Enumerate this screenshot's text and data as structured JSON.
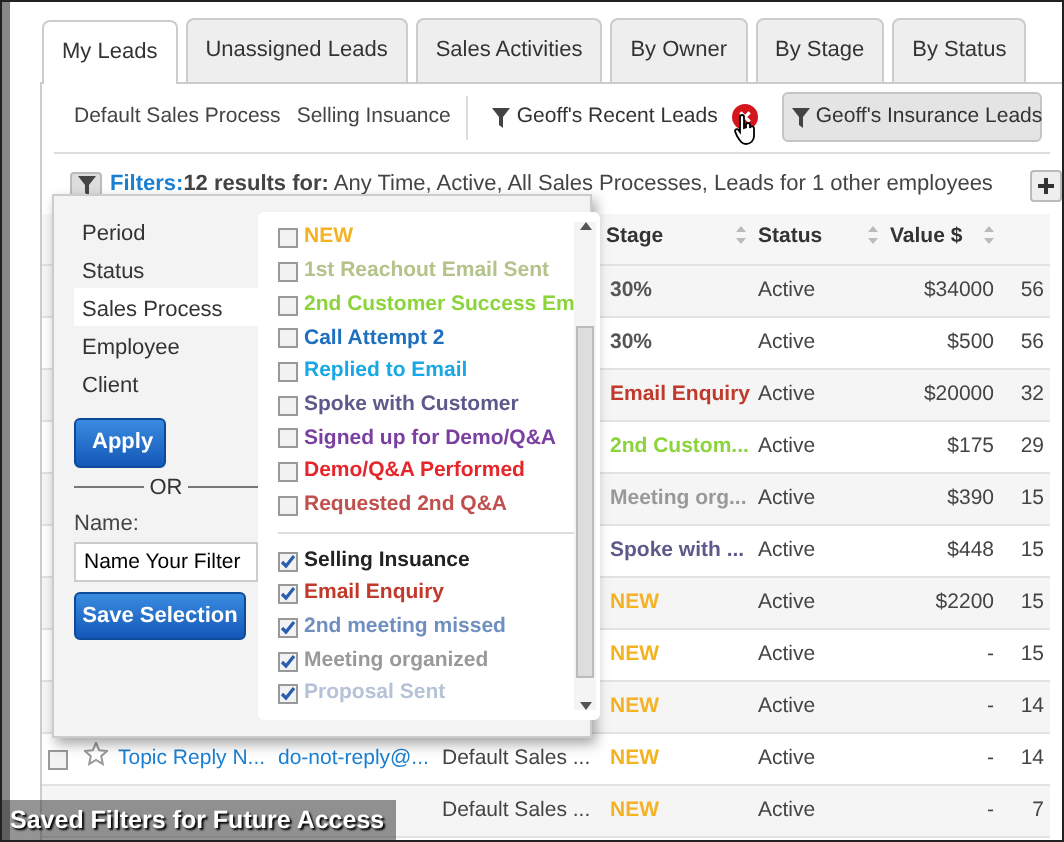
{
  "tabs": [
    {
      "label": "My Leads",
      "selected": true
    },
    {
      "label": "Unassigned Leads",
      "selected": false
    },
    {
      "label": "Sales Activities",
      "selected": false
    },
    {
      "label": "By Owner",
      "selected": false
    },
    {
      "label": "By Stage",
      "selected": false
    },
    {
      "label": "By Status",
      "selected": false
    }
  ],
  "subnav": {
    "processes": [
      "Default Sales Process",
      "Selling Insuance"
    ],
    "saved_filters": [
      {
        "label": "Geoff's Recent Leads",
        "selected": false,
        "removable": true
      },
      {
        "label": "Geoff's Insurance Leads",
        "selected": true,
        "removable": false
      }
    ]
  },
  "filter_bar": {
    "link": "Filters:",
    "summary": "**12 results for:** Any Time, Active, All Sales Processes, Leads for 1 other employees"
  },
  "table": {
    "columns": [
      "Stage",
      "Status",
      "Value $"
    ],
    "rows": [
      {
        "stage": {
          "text": "30%",
          "color": "#555555"
        },
        "status": "Active",
        "value": "$34000",
        "column_9": "56"
      },
      {
        "stage": {
          "text": "30%",
          "color": "#555555"
        },
        "status": "Active",
        "value": "$500",
        "column_9": "56"
      },
      {
        "stage": {
          "text": "Email Enquiry",
          "color": "#c0392b"
        },
        "status": "Active",
        "value": "$20000",
        "column_9": "32"
      },
      {
        "stage": {
          "text": "2nd Custom...",
          "color": "#8cd43c"
        },
        "status": "Active",
        "value": "$175",
        "column_9": "29"
      },
      {
        "stage": {
          "text": "Meeting org...",
          "color": "#999999"
        },
        "status": "Active",
        "value": "$390",
        "column_9": "15"
      },
      {
        "stage": {
          "text": "Spoke with ...",
          "color": "#5c5a8a"
        },
        "status": "Active",
        "value": "$448",
        "column_9": "15"
      },
      {
        "stage": {
          "text": "NEW",
          "color": "#f5b324"
        },
        "status": "Active",
        "value": "$2200",
        "column_9": "15"
      },
      {
        "stage": {
          "text": "NEW",
          "color": "#f5b324"
        },
        "status": "Active",
        "value": "-",
        "column_9": "15"
      },
      {
        "stage": {
          "text": "NEW",
          "color": "#f5b324"
        },
        "status": "Active",
        "value": "-",
        "column_9": "14"
      },
      {
        "checked": false,
        "starred": false,
        "topic": "Topic Reply N...",
        "email": "do-not-reply@...",
        "process": "Default Sales ...",
        "stage": {
          "text": "NEW",
          "color": "#f5b324"
        },
        "status": "Active",
        "value": "-",
        "column_9": "14"
      },
      {
        "process": "Default Sales ...",
        "stage": {
          "text": "NEW",
          "color": "#f5b324"
        },
        "status": "Active",
        "value": "-",
        "column_9": "7"
      }
    ]
  },
  "filter_popup": {
    "menu": [
      {
        "label": "Period",
        "selected": false
      },
      {
        "label": "Status",
        "selected": false
      },
      {
        "label": "Sales Process",
        "selected": true
      },
      {
        "label": "Employee",
        "selected": false
      },
      {
        "label": "Client",
        "selected": false
      }
    ],
    "apply": "Apply",
    "or": "OR",
    "name_label": "Name:",
    "name_value": "Name Your Filter",
    "save": "Save Selection",
    "groups": [
      [
        {
          "label": "NEW",
          "checked": false,
          "color": "#f5b324"
        },
        {
          "label": "1st Reachout Email Sent",
          "checked": false,
          "color": "#b3c38a"
        },
        {
          "label": "2nd Customer Success Em",
          "checked": false,
          "color": "#8cd43c"
        },
        {
          "label": "Call Attempt 2",
          "checked": false,
          "color": "#1f6fbf"
        },
        {
          "label": "Replied to Email",
          "checked": false,
          "color": "#19a8e6"
        },
        {
          "label": "Spoke with Customer",
          "checked": false,
          "color": "#5c5a8a"
        },
        {
          "label": "Signed up for Demo/Q&A",
          "checked": false,
          "color": "#7a3fa0"
        },
        {
          "label": "Demo/Q&A Performed",
          "checked": false,
          "color": "#e6262b"
        },
        {
          "label": "Requested 2nd Q&A",
          "checked": false,
          "color": "#c0504d"
        }
      ],
      [
        {
          "label": "Selling Insuance",
          "checked": true,
          "color": "#222222"
        },
        {
          "label": "Email Enquiry",
          "checked": true,
          "color": "#c0392b"
        },
        {
          "label": "2nd meeting missed",
          "checked": true,
          "color": "#6f8fc0"
        },
        {
          "label": "Meeting organized",
          "checked": true,
          "color": "#999999"
        },
        {
          "label": "Proposal Sent",
          "checked": true,
          "color": "#b5c2d8"
        }
      ]
    ]
  },
  "caption": "Saved Filters for Future Access"
}
